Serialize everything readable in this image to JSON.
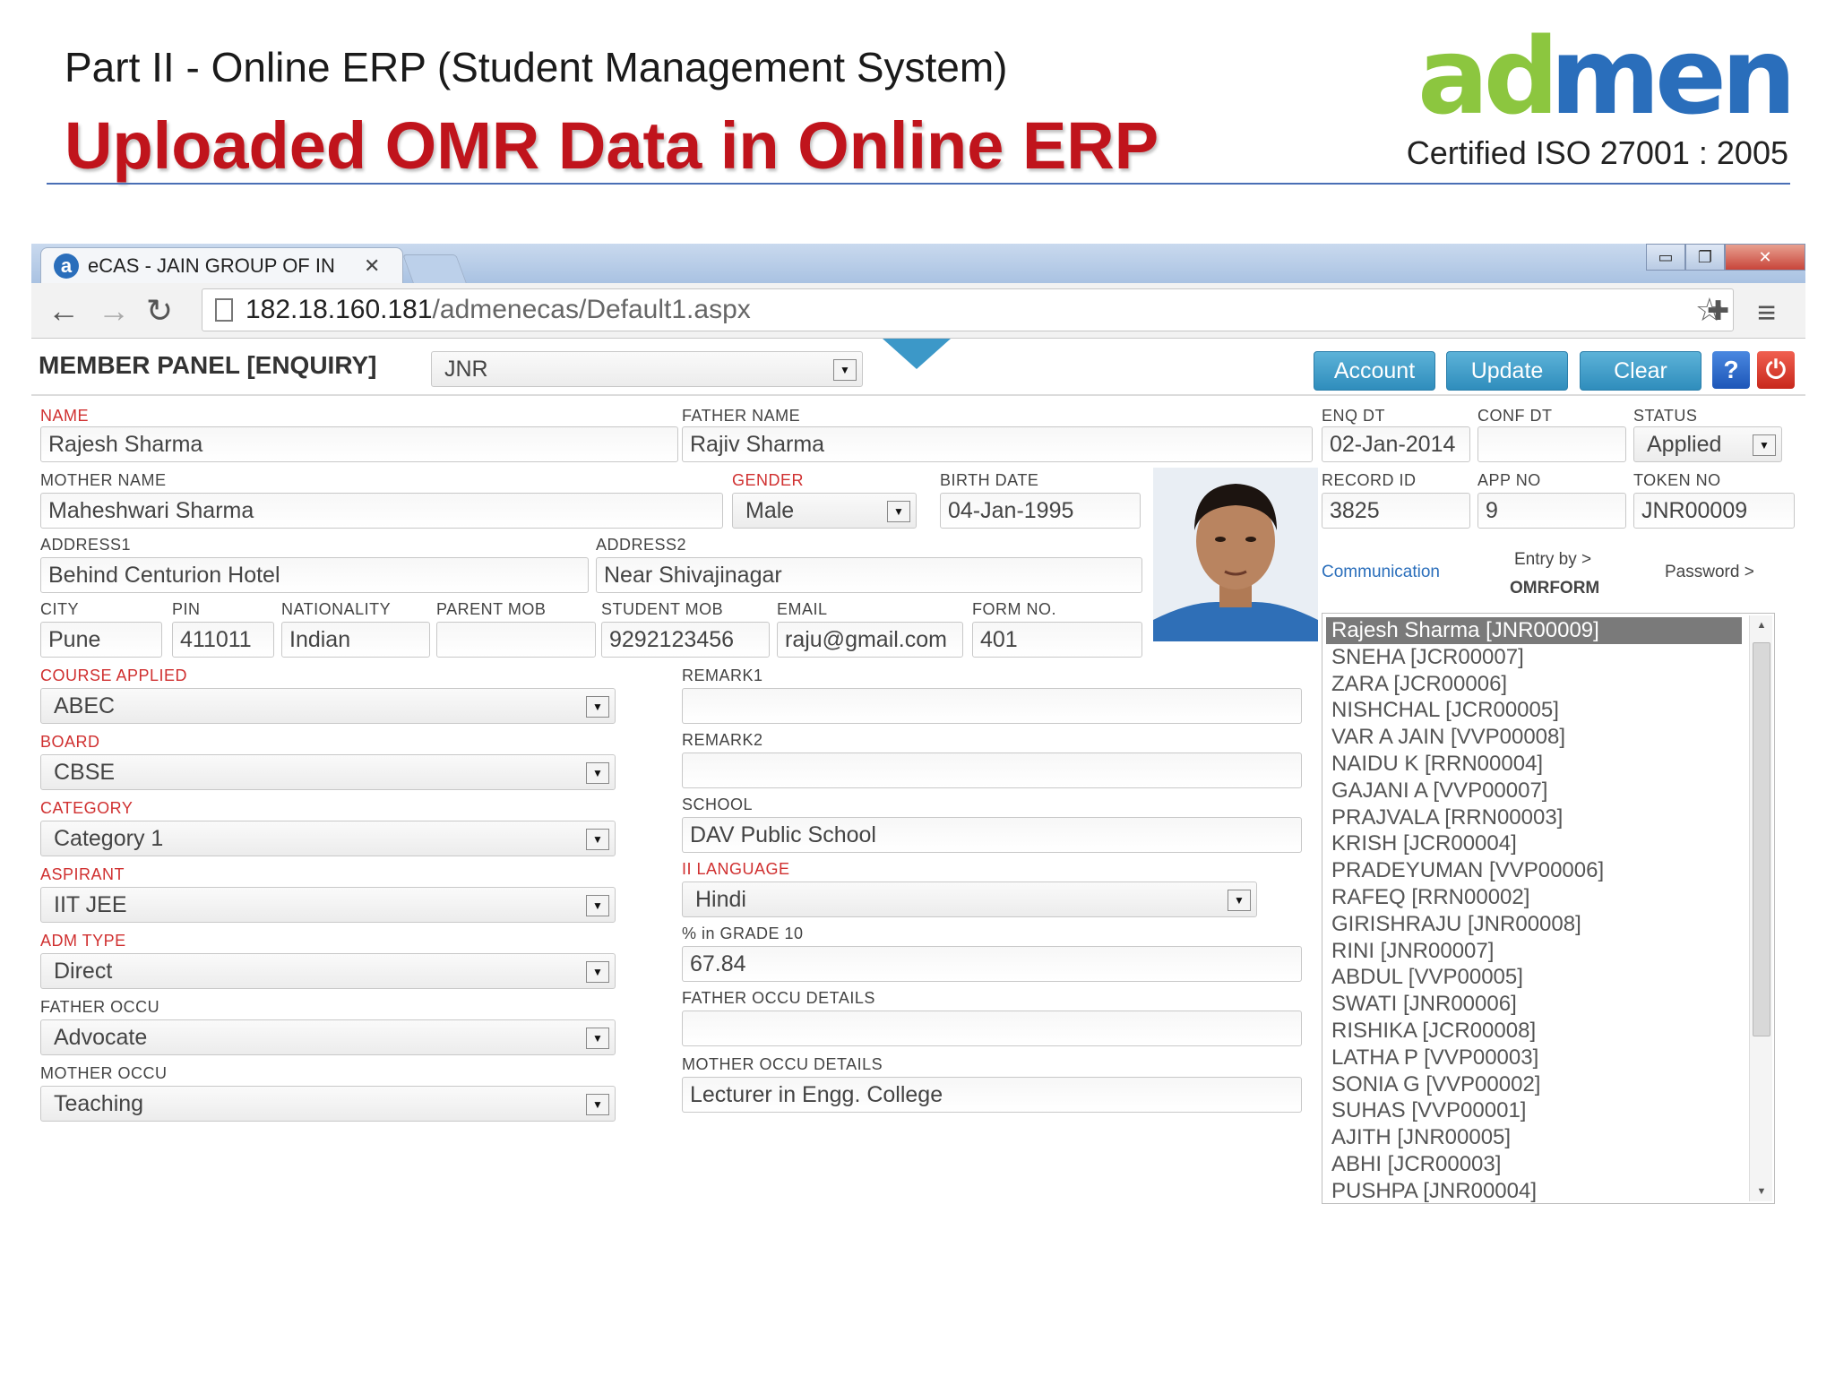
{
  "slide": {
    "subtitle": "Part II - Online ERP (Student Management System)",
    "title": "Uploaded OMR Data in Online ERP",
    "logo": "admen",
    "certified": "Certified ISO 27001 : 2005"
  },
  "colors": {
    "title_red": "#c0141c",
    "logo_green": "#8cc63f",
    "logo_blue": "#2a6ebb",
    "button_blue": "#3c98c8",
    "required_label": "#d03030"
  },
  "browser": {
    "tab_title": "eCAS - JAIN GROUP OF IN",
    "tab_icon": "a",
    "url_host": "182.18.160.181",
    "url_path": "/admenecas/Default1.aspx"
  },
  "header": {
    "panel_title": "MEMBER PANEL [ENQUIRY]",
    "branch_value": "JNR",
    "buttons": {
      "account": "Account",
      "update": "Update",
      "clear": "Clear",
      "help": "?"
    }
  },
  "labels": {
    "name": "NAME",
    "father_name": "FATHER NAME",
    "enq_dt": "ENQ DT",
    "conf_dt": "CONF DT",
    "status": "STATUS",
    "mother_name": "MOTHER NAME",
    "gender": "GENDER",
    "birth_date": "BIRTH DATE",
    "record_id": "RECORD ID",
    "app_no": "APP NO",
    "token_no": "TOKEN NO",
    "address1": "ADDRESS1",
    "address2": "ADDRESS2",
    "city": "CITY",
    "pin": "PIN",
    "nationality": "NATIONALITY",
    "parent_mob": "PARENT MOB",
    "student_mob": "STUDENT MOB",
    "email": "EMAIL",
    "form_no": "FORM NO.",
    "course_applied": "COURSE APPLIED",
    "remark1": "REMARK1",
    "board": "BOARD",
    "remark2": "REMARK2",
    "category": "CATEGORY",
    "school": "SCHOOL",
    "aspirant": "ASPIRANT",
    "ii_language": "II LANGUAGE",
    "adm_type": "ADM TYPE",
    "grade10": "% in GRADE 10",
    "father_occu": "FATHER OCCU",
    "father_occu_details": "FATHER OCCU DETAILS",
    "mother_occu": "MOTHER OCCU",
    "mother_occu_details": "MOTHER OCCU DETAILS"
  },
  "form": {
    "name": "Rajesh Sharma",
    "father_name": "Rajiv Sharma",
    "enq_dt": "02-Jan-2014",
    "conf_dt": "",
    "status": "Applied",
    "mother_name": "Maheshwari Sharma",
    "gender": "Male",
    "birth_date": "04-Jan-1995",
    "record_id": "3825",
    "app_no": "9",
    "token_no": "JNR00009",
    "address1": "Behind Centurion Hotel",
    "address2": "Near Shivajinagar",
    "city": "Pune",
    "pin": "411011",
    "nationality": "Indian",
    "parent_mob": "",
    "student_mob": "9292123456",
    "email": "raju@gmail.com",
    "form_no": "401",
    "course_applied": "ABEC",
    "remark1": "",
    "board": "CBSE",
    "remark2": "",
    "category": "Category 1",
    "school": "DAV Public School",
    "aspirant": "IIT JEE",
    "ii_language": "Hindi",
    "adm_type": "Direct",
    "grade10": "67.84",
    "father_occu": "Advocate",
    "father_occu_details": "",
    "mother_occu": "Teaching",
    "mother_occu_details": "Lecturer in Engg. College"
  },
  "links": {
    "communication": "Communication",
    "entry_by": "Entry by >",
    "entry_source": "OMRFORM",
    "password": "Password >"
  },
  "student_list": [
    "Rajesh Sharma [JNR00009]",
    "SNEHA [JCR00007]",
    "ZARA [JCR00006]",
    "NISHCHAL [JCR00005]",
    "VAR A JAIN [VVP00008]",
    "NAIDU K [RRN00004]",
    "GAJANI A [VVP00007]",
    "PRAJVALA [RRN00003]",
    "KRISH [JCR00004]",
    "PRADEYUMAN [VVP00006]",
    "RAFEQ [RRN00002]",
    "GIRISHRAJU [JNR00008]",
    "RINI [JNR00007]",
    "ABDUL [VVP00005]",
    "SWATI [JNR00006]",
    "RISHIKA [JCR00008]",
    "LATHA P [VVP00003]",
    "SONIA G [VVP00002]",
    "SUHAS [VVP00001]",
    "AJITH [JNR00005]",
    "ABHI [JCR00003]",
    "PUSHPA [JNR00004]"
  ]
}
